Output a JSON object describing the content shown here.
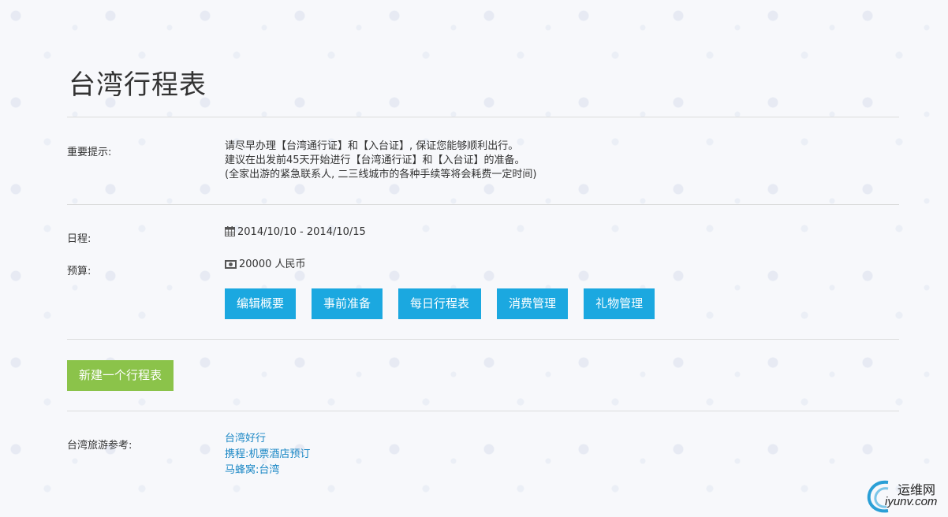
{
  "page": {
    "title": "台湾行程表"
  },
  "notice": {
    "label": "重要提示:",
    "lines": [
      "请尽早办理【台湾通行证】和【入台证】, 保证您能够顺利出行。",
      "建议在出发前45天开始进行【台湾通行证】和【入台证】的准备。",
      "(全家出游的紧急联系人, 二三线城市的各种手续等将会耗费一定时间)"
    ]
  },
  "schedule": {
    "label": "日程:",
    "icon": "calendar-icon",
    "value": "2014/10/10 - 2014/10/15"
  },
  "budget": {
    "label": "预算:",
    "icon": "money-icon",
    "value": "20000 人民币"
  },
  "actions": {
    "buttons": [
      "编辑概要",
      "事前准备",
      "每日行程表",
      "消费管理",
      "礼物管理"
    ],
    "accent": "#1ba8e0"
  },
  "create": {
    "label": "新建一个行程表",
    "color": "#8bc34a"
  },
  "references": {
    "label": "台湾旅游参考:",
    "links": [
      "台湾好行",
      "携程:机票酒店预订",
      "马蜂窝:台湾"
    ],
    "link_color": "#1a87c5"
  },
  "watermark": {
    "cn": "运维网",
    "en": "iyunv.com"
  }
}
